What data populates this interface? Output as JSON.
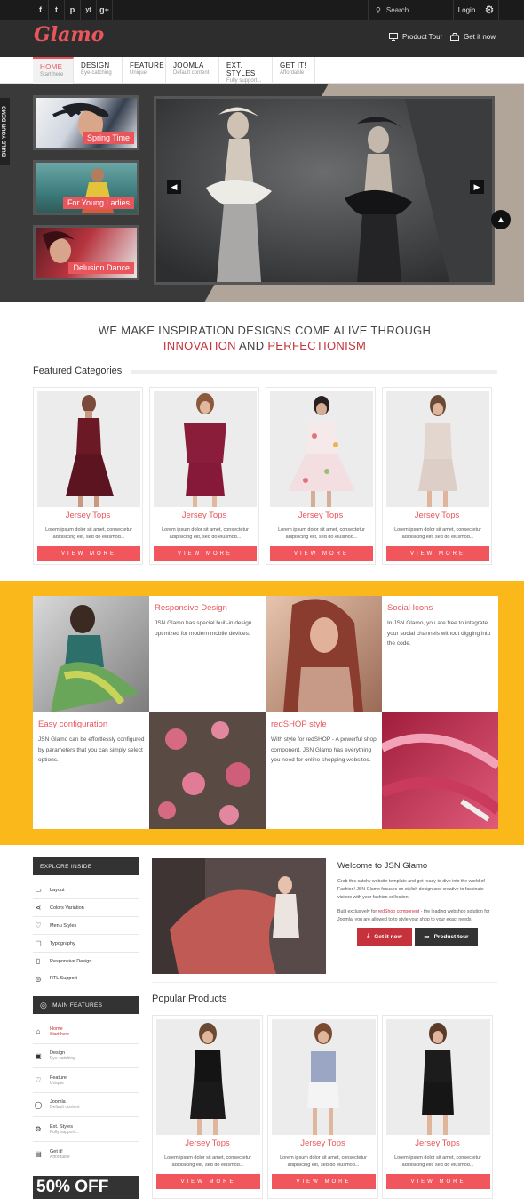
{
  "topbar": {
    "social": [
      "f",
      "t",
      "p",
      "yt",
      "g+"
    ],
    "social_icons": [
      "facebook-icon",
      "twitter-icon",
      "pinterest-icon",
      "youtube-icon",
      "google-plus-icon"
    ],
    "search_placeholder": "Search...",
    "login": "Login"
  },
  "header": {
    "logo": "Glamo",
    "product_tour": "Product Tour",
    "get_it_now": "Get it now"
  },
  "nav": [
    {
      "title": "HOME",
      "sub": "Start here"
    },
    {
      "title": "DESIGN",
      "sub": "Eye-catching"
    },
    {
      "title": "FEATURE",
      "sub": "Unique"
    },
    {
      "title": "JOOMLA",
      "sub": "Default content"
    },
    {
      "title": "EXT. STYLES",
      "sub": "Fully support..."
    },
    {
      "title": "GET IT!",
      "sub": "Affordable"
    }
  ],
  "hero": {
    "demo_tab": "BUILD YOUR DEMO",
    "thumbs": [
      "Spring Time",
      "For Young Ladies",
      "Delusion Dance"
    ]
  },
  "tagline": {
    "line1": "WE MAKE INSPIRATION DESIGNS COME ALIVE THROUGH",
    "word1": "INNOVATION",
    "and": "AND",
    "word2": "PERFECTIONISM"
  },
  "featured": {
    "title": "Featured Categories",
    "items": [
      {
        "name": "Jersey Tops",
        "desc": "Lorem ipsum dolor sit amet, consectetur adipisicing elit, sed do eiusmod...",
        "btn": "VIEW MORE"
      },
      {
        "name": "Jersey Tops",
        "desc": "Lorem ipsum dolor sit amet, consectetur adipisicing elit, sed do eiusmod...",
        "btn": "VIEW MORE"
      },
      {
        "name": "Jersey Tops",
        "desc": "Lorem ipsum dolor sit amet, consectetur adipisicing elit, sed do eiusmod...",
        "btn": "VIEW MORE"
      },
      {
        "name": "Jersey Tops",
        "desc": "Lorem ipsum dolor sit amet, consectetur adipisicing elit, sed do eiusmod...",
        "btn": "VIEW MORE"
      }
    ]
  },
  "features": [
    {
      "title": "Responsive Design",
      "text": "JSN Glamo has special built-in design optimized for modern mobile devices."
    },
    {
      "title": "Social Icons",
      "text": "In JSN Glamo, you are free to integrate your social channels without digging into the code."
    },
    {
      "title": "Easy configuration",
      "text": "JSN Glamo can be effortlessly configured by parameters that you can simply select options."
    },
    {
      "title": "redSHOP style",
      "text": "With style for redSHOP - A powerful shop component, JSN Glamo has everything you need for online shopping websites."
    }
  ],
  "explore": {
    "title": "EXPLORE INSIDE",
    "items": [
      {
        "label": "Layout",
        "icon": "monitor-icon"
      },
      {
        "label": "Colors Variation",
        "icon": "share-icon"
      },
      {
        "label": "Menu Styles",
        "icon": "heart-icon"
      },
      {
        "label": "Typography",
        "icon": "chat-icon"
      },
      {
        "label": "Responsive Design",
        "icon": "mobile-icon"
      },
      {
        "label": "RTL Support",
        "icon": "globe-icon"
      }
    ]
  },
  "main_features": {
    "title": "MAIN FEATURES",
    "items": [
      {
        "label": "Home",
        "sub": "Start here",
        "icon": "home-icon"
      },
      {
        "label": "Design",
        "sub": "Eye-catching",
        "icon": "image-icon"
      },
      {
        "label": "Feature",
        "sub": "Unique",
        "icon": "heart-icon"
      },
      {
        "label": "Joomla",
        "sub": "Default content",
        "icon": "user-icon"
      },
      {
        "label": "Ext. Styles",
        "sub": "Fully support...",
        "icon": "gear-icon"
      },
      {
        "label": "Get it!",
        "sub": "Affordable",
        "icon": "cart-icon"
      }
    ]
  },
  "sale_banner": "50% OFF",
  "welcome": {
    "title": "Welcome to JSN Glamo",
    "p1": "Grab this catchy website template and get ready to dive into the world of Fashion! JSN Glamo focuses on stylish design and creative to fascinate visitors with your fashion collection.",
    "p2_before": "Built exclusively for ",
    "p2_link": "redShop component",
    "p2_after": " - the leading webshop solution for Joomla, you are allowed to to style your shop to your exact needs.",
    "btn_get": "Get it now",
    "btn_tour": "Product tour"
  },
  "popular": {
    "title": "Popular Products",
    "items": [
      {
        "name": "Jersey Tops",
        "desc": "Lorem ipsum dolor sit amet, consectetur adipisicing elit, sed do eiusmod...",
        "btn": "VIEW MORE"
      },
      {
        "name": "Jersey Tops",
        "desc": "Lorem ipsum dolor sit amet, consectetur adipisicing elit, sed do eiusmod...",
        "btn": "VIEW MORE"
      },
      {
        "name": "Jersey Tops",
        "desc": "Lorem ipsum dolor sit amet, consectetur adipisicing elit, sed do eiusmod...",
        "btn": "VIEW MORE"
      }
    ]
  },
  "colors": {
    "accent": "#e8565c",
    "dark": "#2d2d2d",
    "yellow": "#fbb81b"
  }
}
